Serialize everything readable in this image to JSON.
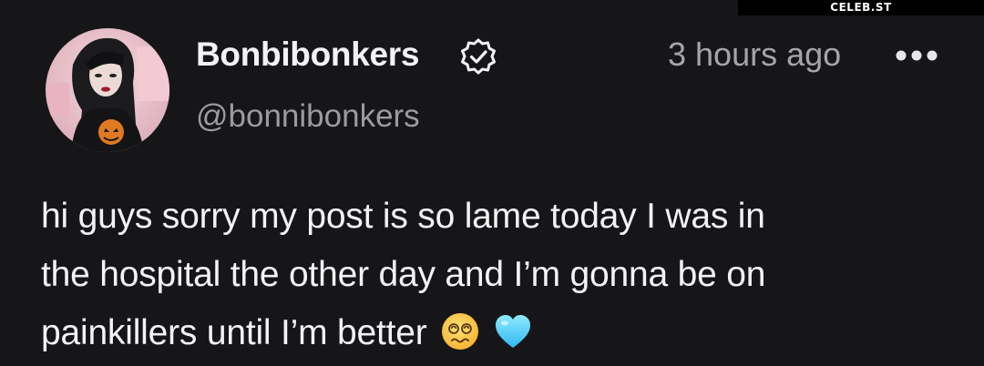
{
  "watermark": "CELEB.ST",
  "post": {
    "author": {
      "display_name": "Bonbibonkers",
      "handle": "@bonnibonkers",
      "verified": true,
      "avatar_icon": "profile-photo"
    },
    "timestamp": "3 hours ago",
    "menu_icon": "more-horizontal-icon",
    "body_lines": [
      "hi guys sorry my post is so lame today I was in",
      "the hospital the other day and I’m gonna be on",
      "painkillers until I’m better"
    ],
    "emojis": [
      "dizzy-face-emoji",
      "light-blue-heart-emoji"
    ]
  },
  "colors": {
    "background": "#161618",
    "text_primary": "#f3f3f5",
    "text_secondary": "#9a9aa2",
    "accent_heart": "#59d3ff"
  }
}
